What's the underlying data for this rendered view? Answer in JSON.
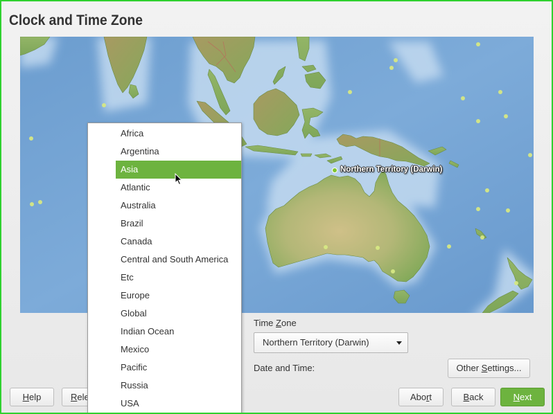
{
  "window": {
    "title": "Clock and Time Zone"
  },
  "map": {
    "marker_label": "Northern Territory (Darwin)"
  },
  "region_list": {
    "items": [
      "Africa",
      "Argentina",
      "Asia",
      "Atlantic",
      "Australia",
      "Brazil",
      "Canada",
      "Central and South America",
      "Etc",
      "Europe",
      "Global",
      "Indian Ocean",
      "Mexico",
      "Pacific",
      "Russia",
      "USA"
    ],
    "selected": "Asia"
  },
  "timezone": {
    "label_pre": "Time ",
    "label_key": "Z",
    "label_post": "one",
    "value": "Northern Territory (Darwin)"
  },
  "datetime": {
    "label": "Date and Time:"
  },
  "other_settings": {
    "pre": "Other ",
    "key": "S",
    "post": "ettings..."
  },
  "buttons": {
    "help": {
      "key": "H",
      "post": "elp"
    },
    "release_notes": {
      "key": "R",
      "post": "ele"
    },
    "abort": {
      "pre": "Abo",
      "key": "r",
      "post": "t"
    },
    "back": {
      "key": "B",
      "post": "ack"
    },
    "next": {
      "key": "N",
      "post": "ext"
    }
  },
  "icons": {
    "dropdown": "chevron-down-icon",
    "cursor": "mouse-cursor-icon"
  },
  "colors": {
    "accent": "#6db33f",
    "frame": "#2fd12f",
    "ocean": "#74a4d4",
    "land": "#8fb365"
  }
}
